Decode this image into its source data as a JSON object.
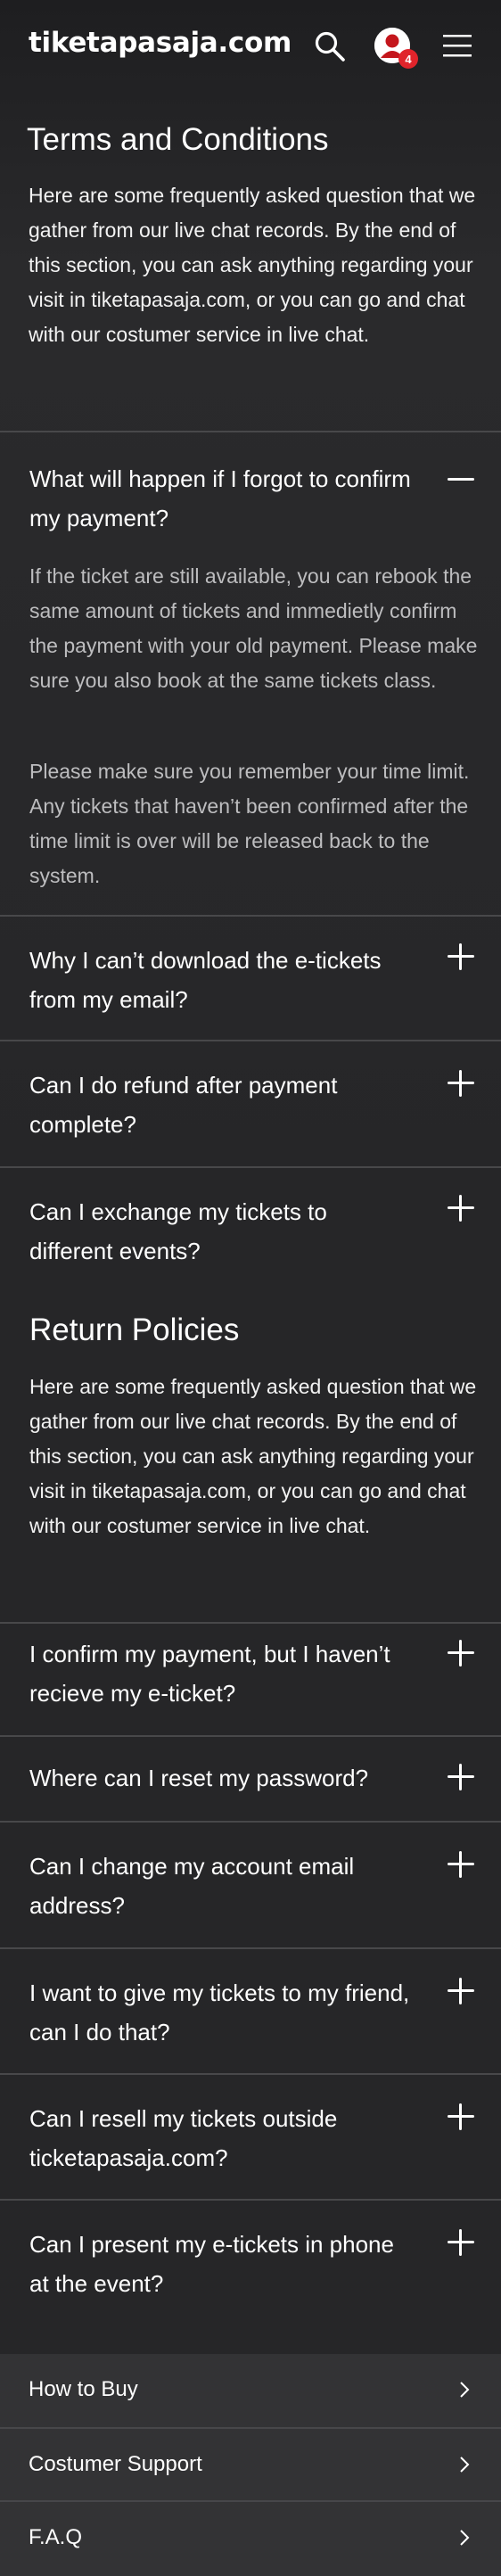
{
  "header": {
    "logo": "tiketapasaja.com",
    "notification_count": "4",
    "icons": {
      "search": "search-icon",
      "avatar": "user-avatar-icon",
      "menu": "hamburger-menu-icon"
    }
  },
  "terms": {
    "title": "Terms and Conditions",
    "intro": "Here are some frequently asked question that we gather from our live chat records. By the end of this section, you can ask anything regarding your visit in tiketapasaja.com, or you can go and chat with our costumer service in live chat.",
    "items": [
      {
        "question": "What will happen if I forgot to confirm my payment?",
        "expanded": true,
        "answer": [
          "If the ticket are still available, you can rebook the same amount of tickets and immedietly confirm the payment with your old payment. Please make sure you also book at the same tickets class.",
          "Please make sure you remember your time limit. Any tickets that haven’t been confirmed after the time limit is over will be released back to the system."
        ]
      },
      {
        "question": "Why I can’t download the e-tickets from my email?",
        "expanded": false
      },
      {
        "question": "Can I do refund after payment complete?",
        "expanded": false
      },
      {
        "question": "Can I exchange my tickets to different events?",
        "expanded": false
      }
    ]
  },
  "returns": {
    "title": "Return Policies",
    "intro": "Here are some frequently asked question that we gather from our live chat records. By the end of this section, you can ask anything regarding your visit in tiketapasaja.com, or you can go and chat with our costumer service in live chat.",
    "items": [
      {
        "question": "I confirm my payment, but I haven’t recieve my e-ticket?",
        "expanded": false
      },
      {
        "question": "Where can I reset my password?",
        "expanded": false
      },
      {
        "question": "Can I change my account email address?",
        "expanded": false
      },
      {
        "question": "I want to give my tickets to my friend, can I do that?",
        "expanded": false
      },
      {
        "question": "Can I resell my tickets outside ticketapasaja.com?",
        "expanded": false
      },
      {
        "question": "Can I present my e-tickets in phone at the event?",
        "expanded": false
      }
    ]
  },
  "footer": {
    "links": [
      {
        "label": "How to Buy"
      },
      {
        "label": "Costumer Support"
      },
      {
        "label": "F.A.Q"
      }
    ]
  },
  "colors": {
    "background": "#262628",
    "footer": "#333335",
    "badge": "#e0242b",
    "divider": "#48484a"
  }
}
